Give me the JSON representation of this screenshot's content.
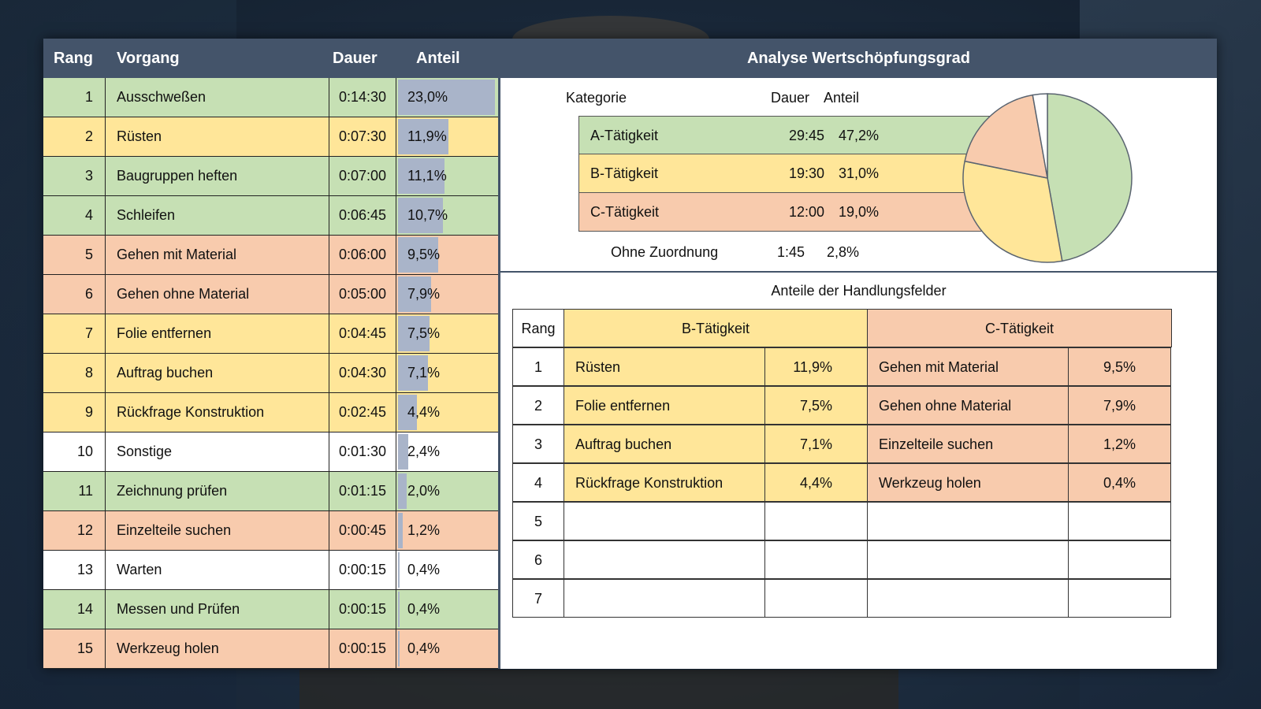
{
  "left_table": {
    "headers": {
      "rang": "Rang",
      "vorgang": "Vorgang",
      "dauer": "Dauer",
      "anteil": "Anteil"
    },
    "rows": [
      {
        "rang": "1",
        "vorgang": "Ausschweßen",
        "dauer": "0:14:30",
        "anteil": "23,0%",
        "share": 23.0,
        "category": "A"
      },
      {
        "rang": "2",
        "vorgang": "Rüsten",
        "dauer": "0:07:30",
        "anteil": "11,9%",
        "share": 11.9,
        "category": "B"
      },
      {
        "rang": "3",
        "vorgang": "Baugruppen heften",
        "dauer": "0:07:00",
        "anteil": "11,1%",
        "share": 11.1,
        "category": "A"
      },
      {
        "rang": "4",
        "vorgang": "Schleifen",
        "dauer": "0:06:45",
        "anteil": "10,7%",
        "share": 10.7,
        "category": "A"
      },
      {
        "rang": "5",
        "vorgang": "Gehen mit Material",
        "dauer": "0:06:00",
        "anteil": "9,5%",
        "share": 9.5,
        "category": "C"
      },
      {
        "rang": "6",
        "vorgang": "Gehen ohne Material",
        "dauer": "0:05:00",
        "anteil": "7,9%",
        "share": 7.9,
        "category": "C"
      },
      {
        "rang": "7",
        "vorgang": "Folie entfernen",
        "dauer": "0:04:45",
        "anteil": "7,5%",
        "share": 7.5,
        "category": "B"
      },
      {
        "rang": "8",
        "vorgang": "Auftrag buchen",
        "dauer": "0:04:30",
        "anteil": "7,1%",
        "share": 7.1,
        "category": "B"
      },
      {
        "rang": "9",
        "vorgang": "Rückfrage Konstruktion",
        "dauer": "0:02:45",
        "anteil": "4,4%",
        "share": 4.4,
        "category": "B"
      },
      {
        "rang": "10",
        "vorgang": "Sonstige",
        "dauer": "0:01:30",
        "anteil": "2,4%",
        "share": 2.4,
        "category": "none"
      },
      {
        "rang": "11",
        "vorgang": "Zeichnung prüfen",
        "dauer": "0:01:15",
        "anteil": "2,0%",
        "share": 2.0,
        "category": "A"
      },
      {
        "rang": "12",
        "vorgang": "Einzelteile suchen",
        "dauer": "0:00:45",
        "anteil": "1,2%",
        "share": 1.2,
        "category": "C"
      },
      {
        "rang": "13",
        "vorgang": "Warten",
        "dauer": "0:00:15",
        "anteil": "0,4%",
        "share": 0.4,
        "category": "none"
      },
      {
        "rang": "14",
        "vorgang": "Messen und Prüfen",
        "dauer": "0:00:15",
        "anteil": "0,4%",
        "share": 0.4,
        "category": "A"
      },
      {
        "rang": "15",
        "vorgang": "Werkzeug holen",
        "dauer": "0:00:15",
        "anteil": "0,4%",
        "share": 0.4,
        "category": "C"
      }
    ]
  },
  "analysis": {
    "title": "Analyse Wertschöpfungsgrad",
    "headers": {
      "kategorie": "Kategorie",
      "dauer": "Dauer",
      "anteil": "Anteil"
    },
    "rows": [
      {
        "kategorie": "A-Tätigkeit",
        "dauer": "29:45",
        "anteil": "47,2%",
        "share": 47.2,
        "category": "A"
      },
      {
        "kategorie": "B-Tätigkeit",
        "dauer": "19:30",
        "anteil": "31,0%",
        "share": 31.0,
        "category": "B"
      },
      {
        "kategorie": "C-Tätigkeit",
        "dauer": "12:00",
        "anteil": "19,0%",
        "share": 19.0,
        "category": "C"
      }
    ],
    "other": {
      "kategorie": "Ohne Zuordnung",
      "dauer": "1:45",
      "anteil": "2,8%",
      "share": 2.8
    }
  },
  "fields": {
    "title": "Anteile der Handlungsfelder",
    "headers": {
      "rang": "Rang",
      "b": "B-Tätigkeit",
      "c": "C-Tätigkeit"
    },
    "rows": [
      {
        "rang": "1",
        "b_name": "Rüsten",
        "b_val": "11,9%",
        "c_name": "Gehen mit Material",
        "c_val": "9,5%"
      },
      {
        "rang": "2",
        "b_name": "Folie entfernen",
        "b_val": "7,5%",
        "c_name": "Gehen ohne Material",
        "c_val": "7,9%"
      },
      {
        "rang": "3",
        "b_name": "Auftrag buchen",
        "b_val": "7,1%",
        "c_name": "Einzelteile suchen",
        "c_val": "1,2%"
      },
      {
        "rang": "4",
        "b_name": "Rückfrage Konstruktion",
        "b_val": "4,4%",
        "c_name": "Werkzeug holen",
        "c_val": "0,4%"
      },
      {
        "rang": "5",
        "b_name": "",
        "b_val": "",
        "c_name": "",
        "c_val": ""
      },
      {
        "rang": "6",
        "b_name": "",
        "b_val": "",
        "c_name": "",
        "c_val": ""
      },
      {
        "rang": "7",
        "b_name": "",
        "b_val": "",
        "c_name": "",
        "c_val": ""
      }
    ]
  },
  "colors": {
    "header": "#44546a",
    "A": "#c6e0b4",
    "B": "#ffe699",
    "C": "#f8cbad",
    "none": "#ffffff",
    "bar": "#a9b4c9"
  }
}
